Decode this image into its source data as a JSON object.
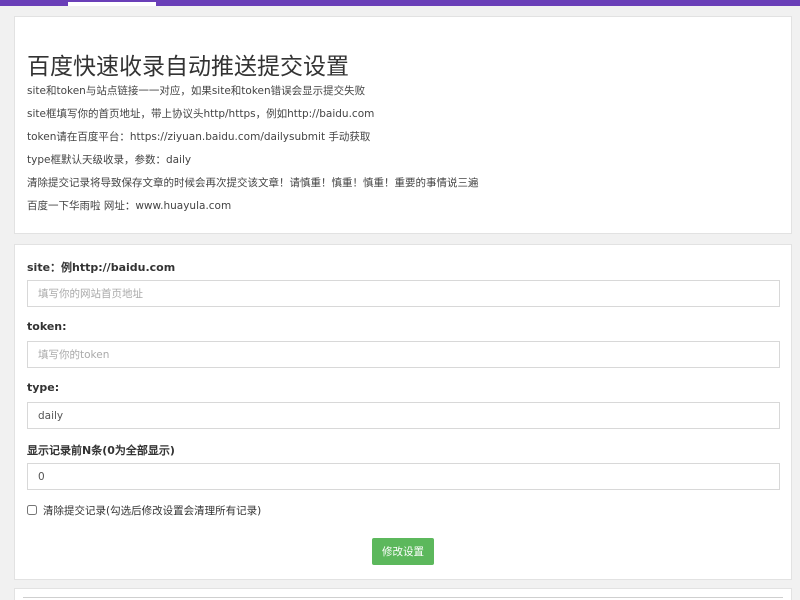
{
  "info": {
    "title": "百度快速收录自动推送提交设置",
    "lines": [
      "site和token与站点链接一一对应，如果site和token错误会显示提交失败",
      "site框填写你的首页地址，带上协议头http/https，例如http://baidu.com",
      "token请在百度平台：https://ziyuan.baidu.com/dailysubmit 手动获取",
      "type框默认天级收录，参数：daily",
      "清除提交记录将导致保存文章的时候会再次提交该文章！请慎重！慎重！慎重！重要的事情说三遍",
      "百度一下华雨啦 网址：www.huayula.com"
    ]
  },
  "form": {
    "site_label": "site：例http://baidu.com",
    "site_placeholder": "填写你的网站首页地址",
    "token_label": "token:",
    "token_placeholder": "填写你的token",
    "type_label": "type:",
    "type_value": "daily",
    "count_label": "显示记录前N条(0为全部显示)",
    "count_value": "0",
    "clear_label": "清除提交记录(勾选后修改设置会清理所有记录)",
    "submit_label": "修改设置"
  },
  "colors": {
    "topbar": "#6a3fb8",
    "submit": "#5cb85c"
  }
}
